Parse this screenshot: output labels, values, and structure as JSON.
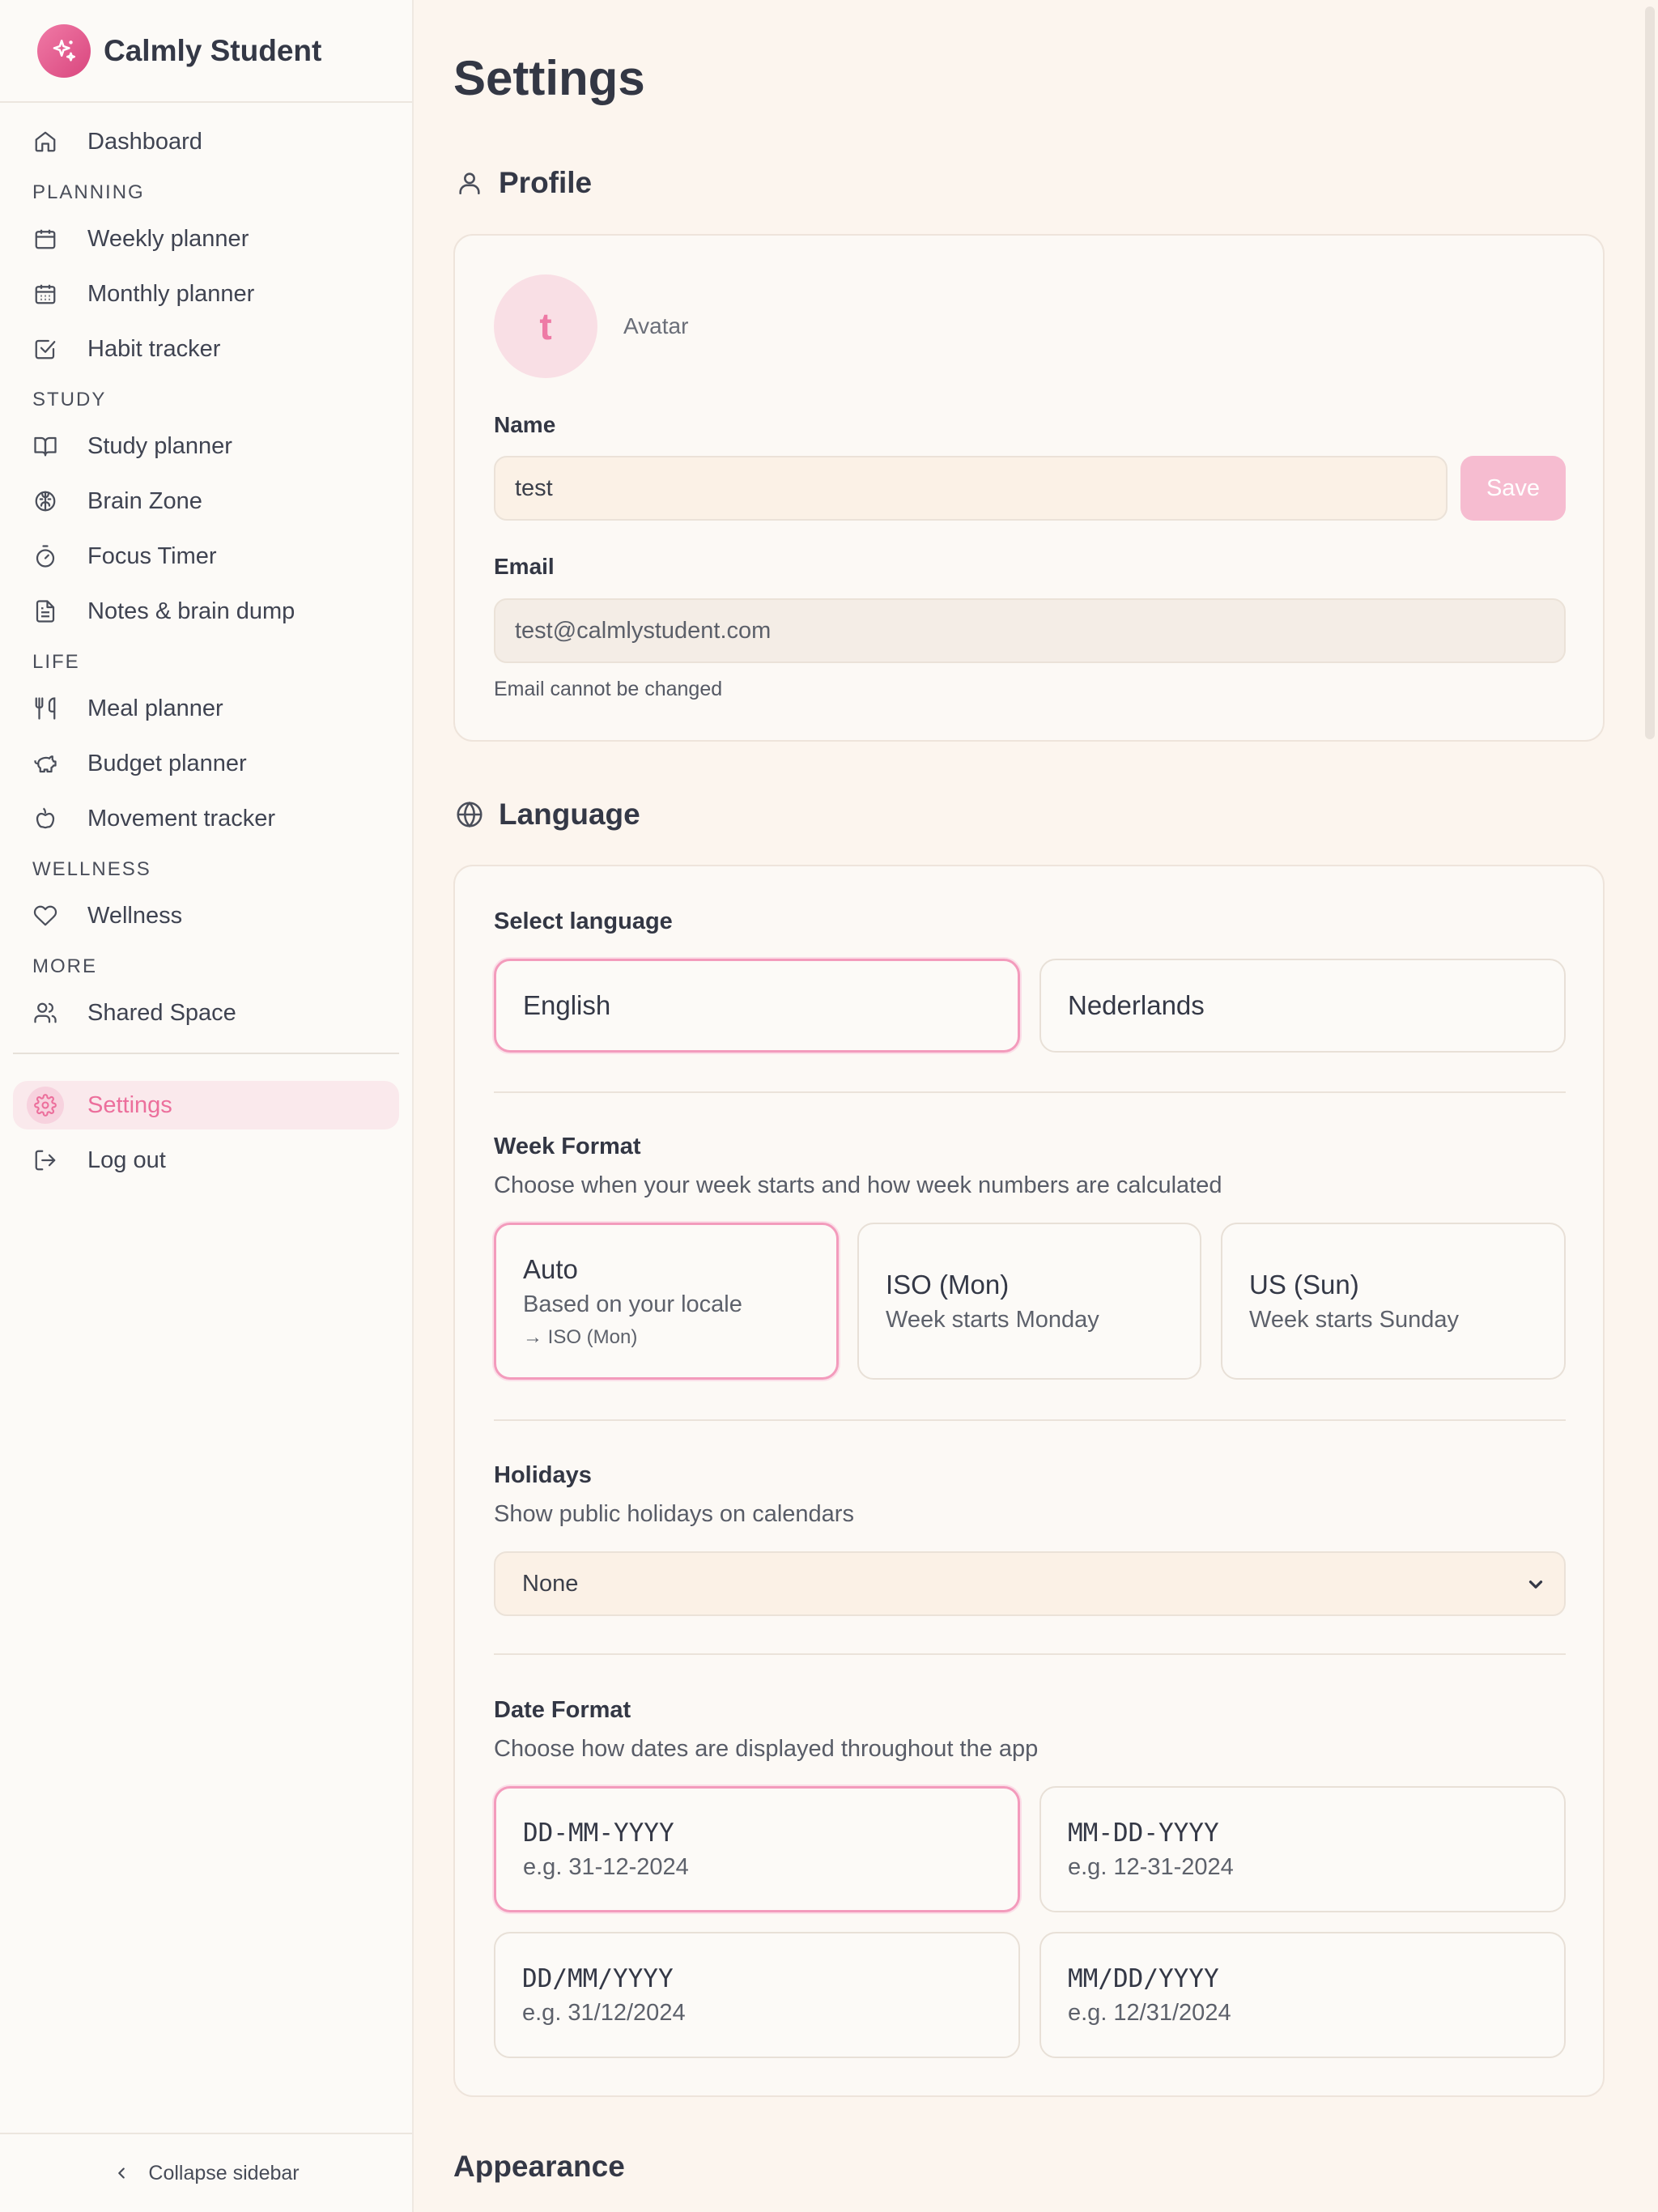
{
  "app": {
    "name": "Calmly Student"
  },
  "sidebar": {
    "items": [
      {
        "label": "Dashboard"
      },
      {
        "label": "Weekly planner"
      },
      {
        "label": "Monthly planner"
      },
      {
        "label": "Habit tracker"
      },
      {
        "label": "Study planner"
      },
      {
        "label": "Brain Zone"
      },
      {
        "label": "Focus Timer"
      },
      {
        "label": "Notes & brain dump"
      },
      {
        "label": "Meal planner"
      },
      {
        "label": "Budget planner"
      },
      {
        "label": "Movement tracker"
      },
      {
        "label": "Wellness"
      },
      {
        "label": "Shared Space"
      },
      {
        "label": "Settings",
        "active": true
      },
      {
        "label": "Log out"
      }
    ],
    "sections": [
      "PLANNING",
      "STUDY",
      "LIFE",
      "WELLNESS",
      "MORE"
    ],
    "collapse_label": "Collapse sidebar"
  },
  "page": {
    "title": "Settings"
  },
  "profile": {
    "heading": "Profile",
    "avatar_initial": "t",
    "avatar_label": "Avatar",
    "name_label": "Name",
    "name_value": "test",
    "save_label": "Save",
    "email_label": "Email",
    "email_value": "test@calmlystudent.com",
    "email_hint": "Email cannot be changed"
  },
  "language": {
    "heading": "Language",
    "select_label": "Select language",
    "options": [
      {
        "label": "English",
        "selected": true
      },
      {
        "label": "Nederlands",
        "selected": false
      }
    ],
    "week_format": {
      "title": "Week Format",
      "desc": "Choose when your week starts and how week numbers are calculated",
      "options": [
        {
          "title": "Auto",
          "desc": "Based on your locale",
          "note": "→ ISO (Mon)",
          "selected": true
        },
        {
          "title": "ISO (Mon)",
          "desc": "Week starts Monday",
          "selected": false
        },
        {
          "title": "US (Sun)",
          "desc": "Week starts Sunday",
          "selected": false
        }
      ]
    },
    "holidays": {
      "title": "Holidays",
      "desc": "Show public holidays on calendars",
      "selected": "None"
    },
    "date_format": {
      "title": "Date Format",
      "desc": "Choose how dates are displayed throughout the app",
      "options": [
        {
          "format": "DD-MM-YYYY",
          "example": "e.g. 31-12-2024",
          "selected": true
        },
        {
          "format": "MM-DD-YYYY",
          "example": "e.g. 12-31-2024",
          "selected": false
        },
        {
          "format": "DD/MM/YYYY",
          "example": "e.g. 31/12/2024",
          "selected": false
        },
        {
          "format": "MM/DD/YYYY",
          "example": "e.g. 12/31/2024",
          "selected": false
        }
      ]
    }
  },
  "appearance": {
    "heading": "Appearance"
  },
  "colors": {
    "accent": "#ec6f9c",
    "background": "#fcf5ee"
  }
}
